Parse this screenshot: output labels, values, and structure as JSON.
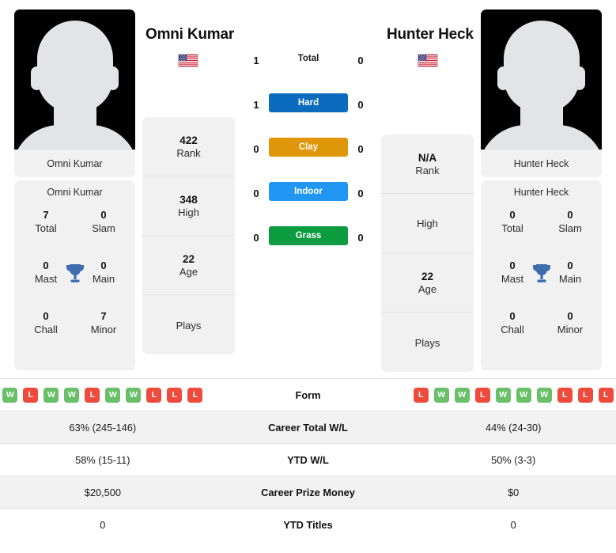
{
  "players": {
    "left": {
      "name": "Omni Kumar",
      "card_name": "Omni Kumar",
      "flag": "us-flag-icon",
      "rank": {
        "rank_value": "422",
        "rank_label": "Rank",
        "high_value": "348",
        "high_label": "High",
        "age_value": "22",
        "age_label": "Age",
        "plays_value": "",
        "plays_label": "Plays"
      },
      "titles": {
        "total_value": "7",
        "total_label": "Total",
        "slam_value": "0",
        "slam_label": "Slam",
        "mast_value": "0",
        "mast_label": "Mast",
        "main_value": "0",
        "main_label": "Main",
        "chall_value": "0",
        "chall_label": "Chall",
        "minor_value": "7",
        "minor_label": "Minor"
      },
      "form": [
        "W",
        "L",
        "W",
        "W",
        "L",
        "W",
        "W",
        "L",
        "L",
        "L"
      ],
      "career_total_wl": "63% (245-146)",
      "ytd_wl": "58% (15-11)",
      "career_prize_money": "$20,500",
      "ytd_titles": "0"
    },
    "right": {
      "name": "Hunter Heck",
      "card_name": "Hunter Heck",
      "flag": "us-flag-icon",
      "rank": {
        "rank_value": "N/A",
        "rank_label": "Rank",
        "high_value": "",
        "high_label": "High",
        "age_value": "22",
        "age_label": "Age",
        "plays_value": "",
        "plays_label": "Plays"
      },
      "titles": {
        "total_value": "0",
        "total_label": "Total",
        "slam_value": "0",
        "slam_label": "Slam",
        "mast_value": "0",
        "mast_label": "Mast",
        "main_value": "0",
        "main_label": "Main",
        "chall_value": "0",
        "chall_label": "Chall",
        "minor_value": "0",
        "minor_label": "Minor"
      },
      "form": [
        "L",
        "W",
        "W",
        "L",
        "W",
        "W",
        "W",
        "L",
        "L",
        "L"
      ],
      "career_total_wl": "44% (24-30)",
      "ytd_wl": "50% (3-3)",
      "career_prize_money": "$0",
      "ytd_titles": "0"
    }
  },
  "head_to_head": {
    "rows": [
      {
        "label": "Total",
        "left": "1",
        "right": "0",
        "badge": false,
        "color": ""
      },
      {
        "label": "Hard",
        "left": "1",
        "right": "0",
        "badge": true,
        "color": "#0b6cbf"
      },
      {
        "label": "Clay",
        "left": "0",
        "right": "0",
        "badge": true,
        "color": "#e09609"
      },
      {
        "label": "Indoor",
        "left": "0",
        "right": "0",
        "badge": true,
        "color": "#2196f3"
      },
      {
        "label": "Grass",
        "left": "0",
        "right": "0",
        "badge": true,
        "color": "#0c9b3e"
      }
    ]
  },
  "stats_table": {
    "rows": [
      {
        "label": "Form",
        "left": "",
        "right": "",
        "type": "form",
        "shaded": false
      },
      {
        "label": "Career Total W/L",
        "left": "63% (245-146)",
        "right": "44% (24-30)",
        "type": "text",
        "shaded": true
      },
      {
        "label": "YTD W/L",
        "left": "58% (15-11)",
        "right": "50% (3-3)",
        "type": "text",
        "shaded": false
      },
      {
        "label": "Career Prize Money",
        "left": "$20,500",
        "right": "$0",
        "type": "text",
        "shaded": true
      },
      {
        "label": "YTD Titles",
        "left": "0",
        "right": "0",
        "type": "text",
        "shaded": false
      }
    ]
  },
  "colors": {
    "win_badge": "#6abf69",
    "loss_badge": "#ef4b3c",
    "trophy": "#3d6daf",
    "card_bg": "#f1f1f1",
    "row_shaded": "#f2f2f2"
  }
}
